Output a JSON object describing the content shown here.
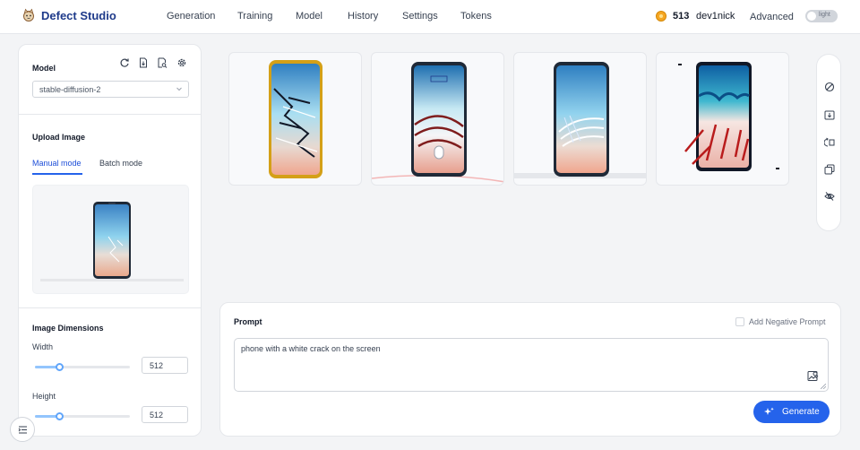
{
  "app": {
    "name": "Defect Studio",
    "logo_icon": "cat-logo-icon"
  },
  "nav": {
    "items": [
      "Generation",
      "Training",
      "Model",
      "History",
      "Settings",
      "Tokens"
    ]
  },
  "account": {
    "token_icon": "coin-icon",
    "token_count": "513",
    "username": "dev1nick",
    "advanced_label": "Advanced",
    "theme_toggle_label": "light"
  },
  "left_panel": {
    "model": {
      "title": "Model",
      "icons": [
        "refresh-icon",
        "file-download-icon",
        "file-search-icon",
        "settings-icon"
      ],
      "selected": "stable-diffusion-2"
    },
    "upload": {
      "title": "Upload Image",
      "tabs": [
        "Manual mode",
        "Batch mode"
      ],
      "active_tab": "Manual mode"
    },
    "dimensions": {
      "title": "Image Dimensions",
      "width_label": "Width",
      "width_value": "512",
      "width_fraction": 0.25,
      "height_label": "Height",
      "height_value": "512",
      "height_fraction": 0.25
    }
  },
  "gallery": {
    "count": 4
  },
  "toolbar": {
    "icons": [
      "clear-icon",
      "download-icon",
      "send-to-icon",
      "copy-icon",
      "eye-off-icon"
    ]
  },
  "prompt": {
    "title": "Prompt",
    "negative_label": "Add Negative Prompt",
    "negative_checked": false,
    "value": "phone with a white crack on the screen",
    "generate_label": "Generate"
  },
  "colors": {
    "accent": "#2563eb",
    "brand_text": "#1e3a8a",
    "background": "#f3f4f6"
  }
}
